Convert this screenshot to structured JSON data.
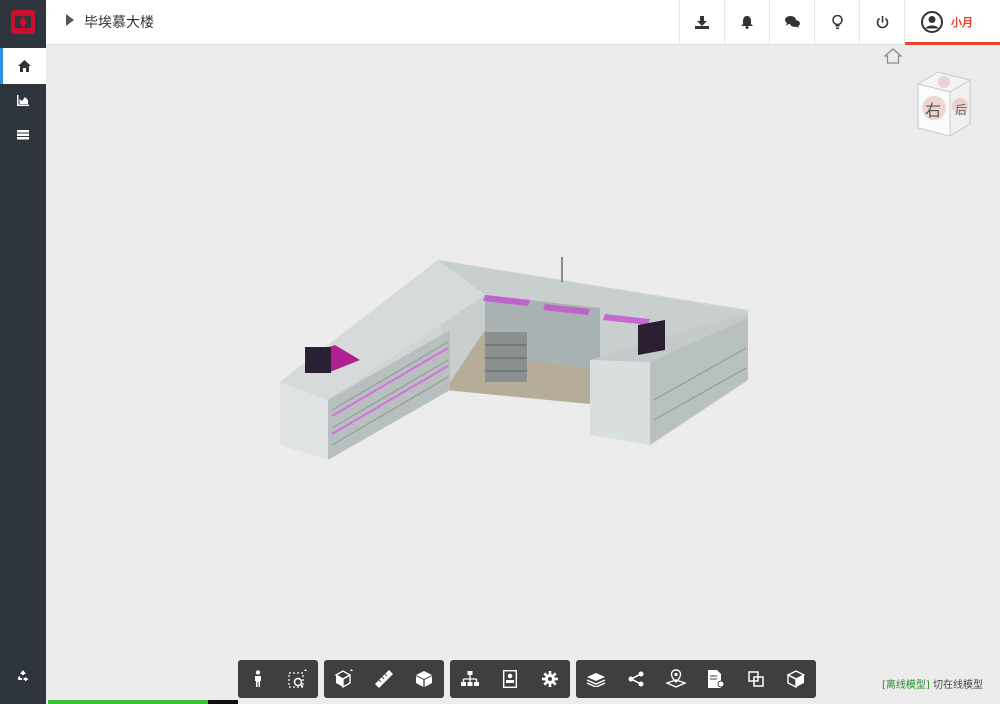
{
  "header": {
    "breadcrumb_title": "毕埃慕大楼"
  },
  "user": {
    "name": "小月"
  },
  "viewcube": {
    "face_front": "右",
    "face_right": "后"
  },
  "status": {
    "mode_offline": "[离线模型]",
    "mode_online": "切在线模型",
    "load_progress": 0.84
  },
  "colors": {
    "accent": "#e8412c",
    "sidebar_bg": "#2e353d",
    "toolbar_bg": "#3f3f3f",
    "active_blue": "#2f8fe8",
    "progress_green": "#3bbd3b"
  }
}
